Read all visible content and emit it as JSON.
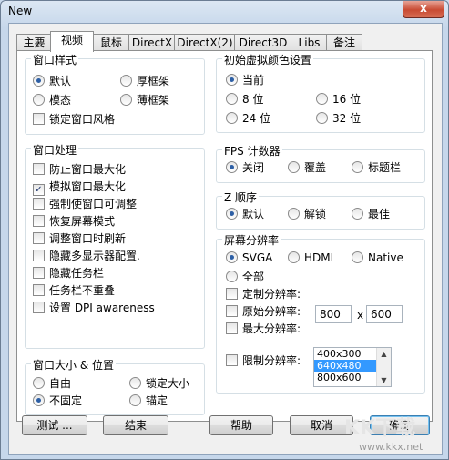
{
  "window": {
    "title": "New",
    "close_glyph": "x"
  },
  "tabs": [
    {
      "label": "主要",
      "active": false
    },
    {
      "label": "视频",
      "active": true
    },
    {
      "label": "鼠标",
      "active": false
    },
    {
      "label": "DirectX",
      "active": false
    },
    {
      "label": "DirectX(2)",
      "active": false
    },
    {
      "label": "Direct3D",
      "active": false
    },
    {
      "label": "Libs",
      "active": false
    },
    {
      "label": "备注",
      "active": false
    }
  ],
  "window_style": {
    "title": "窗口样式",
    "default": "默认",
    "thick_frame": "厚框架",
    "modal": "模态",
    "thin_frame": "薄框架",
    "lock_style": "锁定窗口风格",
    "selected": "default"
  },
  "window_handling": {
    "title": "窗口处理",
    "items": [
      {
        "label": "防止窗口最大化",
        "checked": false
      },
      {
        "label": "模拟窗口最大化",
        "checked": true
      },
      {
        "label": "强制使窗口可调整",
        "checked": false
      },
      {
        "label": "恢复屏幕模式",
        "checked": false
      },
      {
        "label": "调整窗口时刷新",
        "checked": false
      },
      {
        "label": "隐藏多显示器配置.",
        "checked": false
      },
      {
        "label": "隐藏任务栏",
        "checked": false
      },
      {
        "label": "任务栏不重叠",
        "checked": false
      },
      {
        "label": "设置 DPI awareness",
        "checked": false
      }
    ]
  },
  "window_size_pos": {
    "title": "窗口大小 & 位置",
    "free": "自由",
    "lock_size": "锁定大小",
    "not_fixed": "不固定",
    "anchor": "锚定",
    "selected": "not_fixed"
  },
  "initial_color": {
    "title": "初始虚拟颜色设置",
    "current": "当前",
    "bit8": "8 位",
    "bit16": "16 位",
    "bit24": "24 位",
    "bit32": "32 位",
    "selected": "current"
  },
  "fps": {
    "title": "FPS 计数器",
    "off": "关闭",
    "overlay": "覆盖",
    "titlebar": "标题栏",
    "selected": "off"
  },
  "zorder": {
    "title": "Z 顺序",
    "default": "默认",
    "unlock": "解锁",
    "topmost": "最佳",
    "selected": "default"
  },
  "resolution": {
    "title": "屏幕分辨率",
    "svga": "SVGA",
    "hdmi": "HDMI",
    "native": "Native",
    "all": "全部",
    "selected": "svga",
    "custom_res": "定制分辨率:",
    "original_res": "原始分辨率:",
    "max_res": "最大分辨率:",
    "width_value": "800",
    "x_sep": "x",
    "height_value": "600",
    "limit_res": "限制分辨率:",
    "list": [
      "400x300",
      "640x480",
      "800x600"
    ],
    "list_selected": 1
  },
  "buttons": {
    "test": "测试 ...",
    "end": "结束",
    "help": "帮助",
    "cancel": "取消",
    "ok": "确定"
  },
  "watermark": {
    "brand": "KK下载",
    "url": "www.kkx.net"
  },
  "colors": {
    "accent": "#3399ff",
    "titlebar": "#c6d7eb",
    "close": "#c84b33"
  }
}
